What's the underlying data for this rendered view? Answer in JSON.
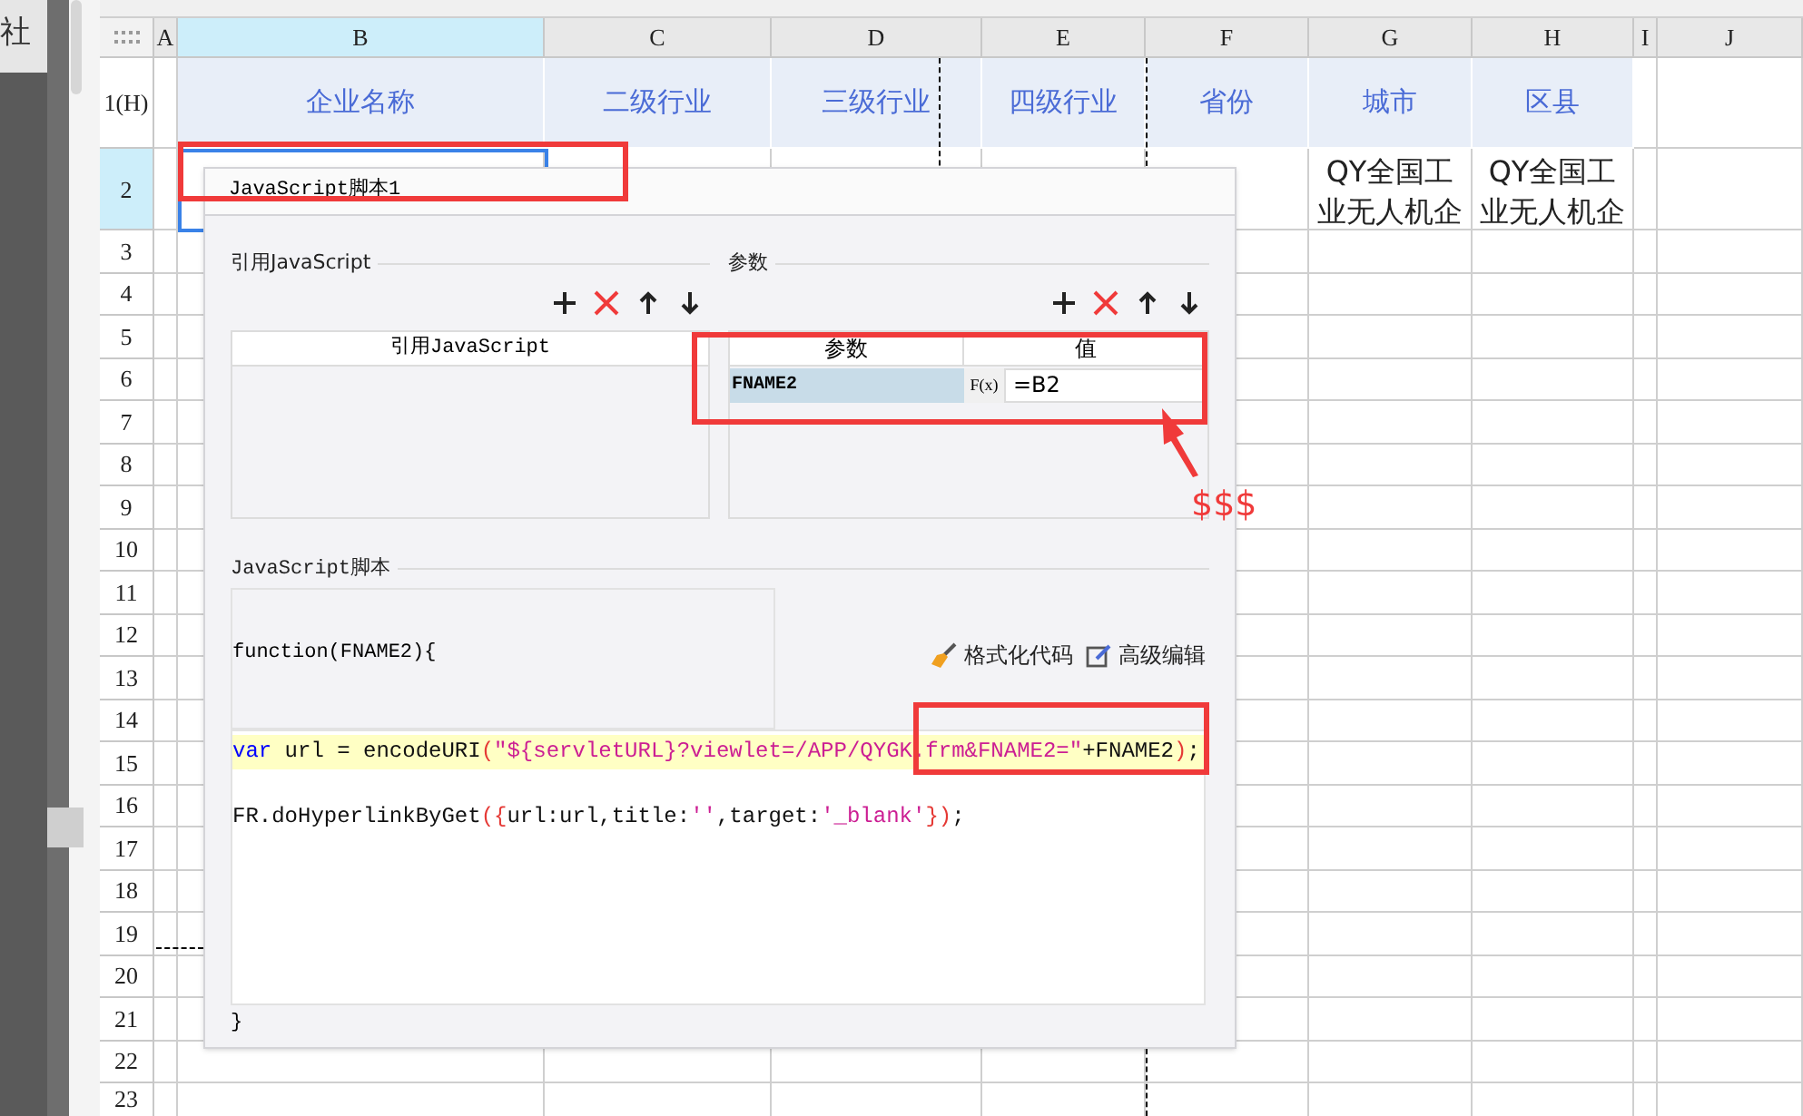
{
  "sidebar": {
    "label": "社"
  },
  "sheet": {
    "columns": [
      {
        "label": "A",
        "selected": false
      },
      {
        "label": "B",
        "selected": true
      },
      {
        "label": "C",
        "selected": false
      },
      {
        "label": "D",
        "selected": false
      },
      {
        "label": "E",
        "selected": false
      },
      {
        "label": "F",
        "selected": false
      },
      {
        "label": "G",
        "selected": false
      },
      {
        "label": "H",
        "selected": false
      },
      {
        "label": "I",
        "selected": false
      },
      {
        "label": "J",
        "selected": false
      }
    ],
    "rows": [
      {
        "label": "1(H)",
        "selected": false,
        "kind": "header",
        "cells": [
          null,
          "企业名称",
          "二级行业",
          "三级行业",
          "四级行业",
          "省份",
          "城市",
          "区县"
        ]
      },
      {
        "label": "2",
        "selected": true,
        "kind": "data",
        "cells": [
          null,
          null,
          null,
          null,
          null,
          null,
          "QY全国工业无人机企",
          "QY全国工业无人机企"
        ]
      },
      {
        "label": "3",
        "selected": false
      },
      {
        "label": "4",
        "selected": false
      },
      {
        "label": "5",
        "selected": false
      },
      {
        "label": "6",
        "selected": false
      },
      {
        "label": "7",
        "selected": false
      },
      {
        "label": "8",
        "selected": false
      },
      {
        "label": "9",
        "selected": false
      },
      {
        "label": "10",
        "selected": false
      },
      {
        "label": "11",
        "selected": false
      },
      {
        "label": "12",
        "selected": false
      },
      {
        "label": "13",
        "selected": false
      },
      {
        "label": "14",
        "selected": false
      },
      {
        "label": "15",
        "selected": false
      },
      {
        "label": "16",
        "selected": false
      },
      {
        "label": "17",
        "selected": false
      },
      {
        "label": "18",
        "selected": false
      },
      {
        "label": "19",
        "selected": false
      },
      {
        "label": "20",
        "selected": false
      },
      {
        "label": "21",
        "selected": false
      },
      {
        "label": "22",
        "selected": false
      },
      {
        "label": "23",
        "selected": false
      }
    ]
  },
  "dialog": {
    "title": "JavaScript脚本1",
    "references": {
      "label": "引用JavaScript",
      "column": "引用JavaScript"
    },
    "parameters": {
      "label": "参数",
      "columns": [
        "参数",
        "值"
      ],
      "rows": [
        {
          "name": "FNAME2",
          "formula_button": "F(x)",
          "value": "=B2",
          "selected": true
        }
      ]
    },
    "script": {
      "label": "JavaScript脚本",
      "signature": "function(FNAME2){",
      "actions": [
        "格式化代码",
        "高级编辑"
      ],
      "lines": [
        {
          "highlighted": true,
          "tokens": [
            {
              "kind": "keyword",
              "text": "var"
            },
            {
              "kind": "plain",
              "text": " url = encodeURI"
            },
            {
              "kind": "bracket",
              "text": "("
            },
            {
              "kind": "string",
              "text": "\"${servletURL}?viewlet=/APP/QYGK.frm&FNAME2=\""
            },
            {
              "kind": "plain",
              "text": "+FNAME2"
            },
            {
              "kind": "bracket",
              "text": ")"
            },
            {
              "kind": "plain",
              "text": ";"
            }
          ]
        },
        {
          "highlighted": false,
          "tokens": [
            {
              "kind": "plain",
              "text": "FR.doHyperlinkByGet"
            },
            {
              "kind": "bracket",
              "text": "({"
            },
            {
              "kind": "plain",
              "text": "url:url,title:"
            },
            {
              "kind": "string",
              "text": "''"
            },
            {
              "kind": "plain",
              "text": ",target:"
            },
            {
              "kind": "string",
              "text": "'_blank'"
            },
            {
              "kind": "bracket",
              "text": "})"
            },
            {
              "kind": "plain",
              "text": ";"
            }
          ]
        }
      ],
      "closing": "}"
    }
  },
  "annotation": {
    "text": "$$$"
  }
}
